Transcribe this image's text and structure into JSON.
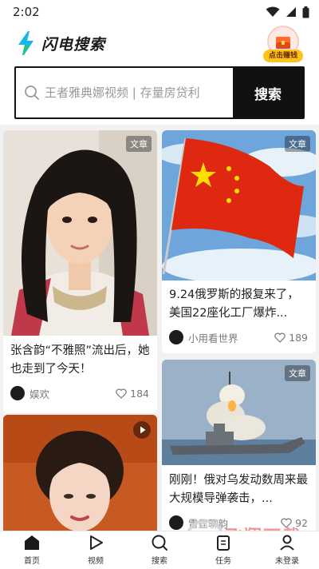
{
  "status_bar": {
    "time": "2:02"
  },
  "header": {
    "app_name": "闪电搜索",
    "reward_label": "点击赚钱"
  },
  "search": {
    "placeholder": "王者雅典娜视频 | 存量房贷利",
    "button_label": "搜索"
  },
  "feed": [
    {
      "tag": "文章",
      "title": "张含韵“不雅照”流出后，她也走到了今天！",
      "author": "娱欢",
      "likes": "184",
      "image": "portrait-girl"
    },
    {
      "tag": "文章",
      "title": "9.24俄罗斯的报复来了，美国22座化工厂爆炸...",
      "author": "小用看世界",
      "likes": "189",
      "image": "chinese-flag"
    },
    {
      "tag": "文章",
      "title": "刚刚！俄对乌发动数周来最大规模导弹袭击，...",
      "author": "雷霆聊韵",
      "likes": "92",
      "image": "warship-missile"
    },
    {
      "tag": "video-badge",
      "title": "",
      "author": "",
      "likes": "",
      "image": "portrait-woman"
    }
  ],
  "tab_bar": [
    {
      "label": "首页",
      "icon": "home-icon",
      "active": true
    },
    {
      "label": "视频",
      "icon": "play-icon",
      "active": false
    },
    {
      "label": "搜索",
      "icon": "search-icon",
      "active": false
    },
    {
      "label": "任务",
      "icon": "task-icon",
      "active": false
    },
    {
      "label": "未登录",
      "icon": "user-icon",
      "active": false
    }
  ],
  "watermark": {
    "text": "飞翔下载",
    "url": "www.FXXZ.COM"
  },
  "colors": {
    "search_button": "#111111",
    "reward_badge": "#ffc21a",
    "flag_red": "#de2910",
    "flag_star": "#ffde00"
  }
}
